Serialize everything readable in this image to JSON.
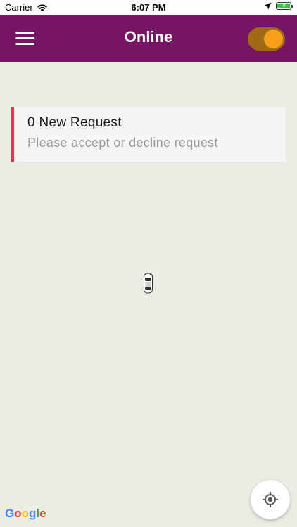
{
  "status_bar": {
    "carrier": "Carrier",
    "time": "6:07 PM"
  },
  "header": {
    "title": "Online",
    "online_toggle_on": true
  },
  "request_card": {
    "title": "0 New Request",
    "subtitle": "Please accept or decline request"
  },
  "map": {
    "attribution": [
      "G",
      "o",
      "o",
      "g",
      "l",
      "e"
    ],
    "attribution_colors": [
      "#4285f4",
      "#ea4335",
      "#fbbc05",
      "#4285f4",
      "#34a853",
      "#ea4335"
    ]
  },
  "colors": {
    "header_bg": "#751563",
    "accent": "#e6324b",
    "toggle_knob": "#f6a01a",
    "map_bg": "#ecebe4"
  },
  "icons": {
    "menu": "hamburger-menu-icon",
    "locate": "my-location-icon",
    "car": "car-marker-icon",
    "wifi": "wifi-icon",
    "location_arrow": "location-arrow-icon",
    "battery": "battery-charging-icon"
  }
}
